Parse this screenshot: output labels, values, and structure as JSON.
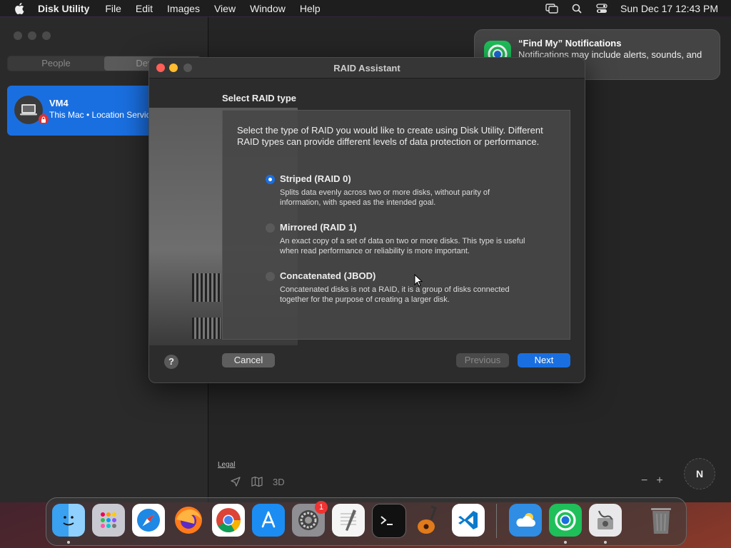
{
  "menubar": {
    "app_name": "Disk Utility",
    "items": [
      "File",
      "Edit",
      "Images",
      "View",
      "Window",
      "Help"
    ],
    "clock": "Sun Dec 17  12:43 PM",
    "icons": [
      "apple-icon",
      "screen-mirroring-icon",
      "spotlight-search-icon",
      "control-center-icon"
    ]
  },
  "findmy": {
    "tabs": [
      "People",
      "Devices"
    ],
    "active_tab": "Devices",
    "device": {
      "name": "VM4",
      "subtitle": "This Mac • Location Services Off"
    },
    "legal": "Legal",
    "map_mode": "3D",
    "compass": "N",
    "zoom_out": "−",
    "zoom_in": "+"
  },
  "notification": {
    "title": "“Find My” Notifications",
    "body": "Notifications may include alerts, sounds, and icon badges."
  },
  "dialog": {
    "title": "RAID Assistant",
    "section_label": "Select RAID type",
    "intro": "Select the type of RAID you would like to create using Disk Utility. Different RAID types can provide different levels of data protection or performance.",
    "options": [
      {
        "title": "Striped (RAID 0)",
        "desc": "Splits data evenly across two or more disks, without parity of information, with speed as the intended goal.",
        "selected": true
      },
      {
        "title": "Mirrored (RAID 1)",
        "desc": "An exact copy of a set of data on two or more disks. This type is useful when read performance or reliability is more important.",
        "selected": false
      },
      {
        "title": "Concatenated (JBOD)",
        "desc": "Concatenated disks is not a RAID, it is a group of disks connected together for the purpose of creating a larger disk.",
        "selected": false
      }
    ],
    "help_label": "?",
    "cancel_label": "Cancel",
    "previous_label": "Previous",
    "next_label": "Next"
  },
  "dock": {
    "apps": [
      "Finder",
      "Launchpad",
      "Safari",
      "Firefox",
      "Chrome",
      "App Store",
      "System Settings",
      "TextEdit",
      "Terminal",
      "GarageBand",
      "Visual Studio Code",
      "Weather",
      "Find My",
      "Disk Utility",
      "Trash"
    ],
    "settings_badge": "1"
  },
  "colors": {
    "accent": "#1a6fe0",
    "menubar": "#1e1e1e",
    "dialog": "#2c2c2c"
  }
}
